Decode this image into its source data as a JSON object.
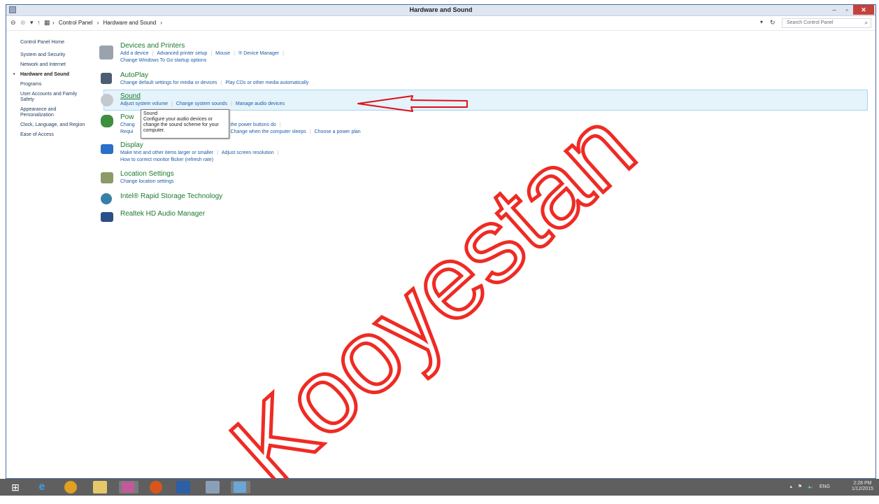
{
  "window": {
    "title": "Hardware and Sound"
  },
  "address": {
    "crumbs": [
      "Control Panel",
      "Hardware and Sound"
    ],
    "search_placeholder": "Search Control Panel"
  },
  "left_nav": [
    "Control Panel Home",
    "System and Security",
    "Network and Internet",
    "Hardware and Sound",
    "Programs",
    "User Accounts and Family Safety",
    "Appearance and Personalization",
    "Clock, Language, and Region",
    "Ease of Access"
  ],
  "categories": {
    "devices": {
      "title": "Devices and Printers",
      "links": [
        "Add a device",
        "Advanced printer setup",
        "Mouse",
        "Device Manager"
      ],
      "links2": [
        "Change Windows To Go startup options"
      ]
    },
    "autoplay": {
      "title": "AutoPlay",
      "links": [
        "Change default settings for media or devices",
        "Play CDs or other media automatically"
      ]
    },
    "sound": {
      "title": "Sound",
      "links": [
        "Adjust system volume",
        "Change system sounds",
        "Manage audio devices"
      ]
    },
    "power": {
      "title": "Pow",
      "links": [
        "Chang",
        "what the power buttons do"
      ],
      "links2": [
        "Requi",
        "es",
        "Change when the computer sleeps",
        "Choose a power plan"
      ]
    },
    "display": {
      "title": "Display",
      "links": [
        "Make text and other items larger or smaller",
        "Adjust screen resolution"
      ],
      "links2": [
        "How to correct monitor flicker (refresh rate)"
      ]
    },
    "location": {
      "title": "Location Settings",
      "links": [
        "Change location settings"
      ]
    },
    "intel": {
      "title": "Intel® Rapid Storage Technology"
    },
    "realtek": {
      "title": "Realtek HD Audio Manager"
    }
  },
  "tooltip": {
    "title": "Sound",
    "text": "Configure your audio devices or change the sound scheme for your computer."
  },
  "watermark": "Kooyestan",
  "taskbar": {
    "lang": "ENG",
    "time": "2:28 PM",
    "date": "1/12/2015"
  }
}
